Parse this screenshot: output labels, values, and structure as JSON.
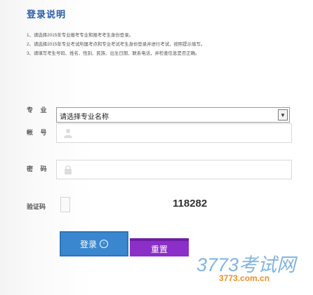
{
  "title": "登录说明",
  "notes": [
    "1、请选择2015年专业报考专业和报考考生身份登录。",
    "2、请选择2015年专业考试所属考点和专业考试考生身份登录并进行考试，按照提示填写。",
    "3、请填写考生号码、姓名、性别、民族、出生日期、联系电话，并检查信息是否正确。"
  ],
  "major": {
    "label": "专 业",
    "selected": "请选择专业名称"
  },
  "account": {
    "label": "帐 号",
    "value": ""
  },
  "password": {
    "label": "密 码",
    "value": ""
  },
  "captcha": {
    "label": "验证码",
    "code": "118282"
  },
  "buttons": {
    "login": "登录",
    "reset": "重置"
  },
  "logo": {
    "text": "3773考试网",
    "url_text": "3773.com.cn"
  },
  "colors": {
    "login_button": "#3a87cf",
    "reset_button": "#8b2fc8",
    "logo": "#6aa8dc",
    "url": "#e8912a"
  }
}
